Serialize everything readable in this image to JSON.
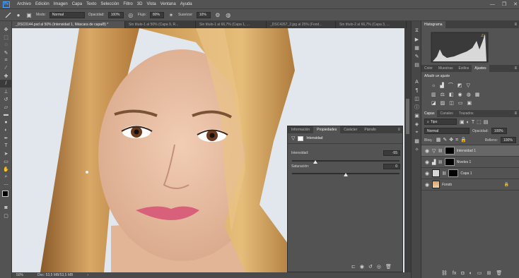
{
  "app": {
    "logo": "Ps"
  },
  "menu": [
    "Archivo",
    "Edición",
    "Imagen",
    "Capa",
    "Texto",
    "Selección",
    "Filtro",
    "3D",
    "Vista",
    "Ventana",
    "Ayuda"
  ],
  "window_controls": {
    "minimize": "—",
    "restore": "❐",
    "close": "✕"
  },
  "options": {
    "mode_label": "Modo:",
    "mode_value": "Normal",
    "opacity_label": "Opacidad:",
    "opacity_value": "100%",
    "flow_label": "Flujo:",
    "flow_value": "80%",
    "smooth_label": "Suavizar:",
    "smooth_value": "10%"
  },
  "tabs": [
    "_DSC0144.psd al 50% (Intensidad 1, Máscara de capa/8) *",
    "Sin título-1 al 50% (Capa 9, R...",
    "Sin título-1 al 66,7% (Capa 1, ...",
    "_DSC4267_2.jpg al 25% (Fond...",
    "Sin título-2 al 66,7% (Capa 3, ..."
  ],
  "status": {
    "zoom": "50%",
    "doc": "Doc: 53,5 MB/53,5 MB",
    "arrow": "›"
  },
  "properties": {
    "tabs": [
      "Información",
      "Propiedades",
      "Carácter",
      "Párrafo"
    ],
    "active_tab": 1,
    "adjustment": "Intensidad",
    "intensity_label": "Intensidad:",
    "intensity_value": "-55",
    "intensity_pos": 0.22,
    "saturation_label": "Saturación:",
    "saturation_value": "0",
    "saturation_pos": 0.5
  },
  "histogram": {
    "tab": "Histograma"
  },
  "adjust_panel": {
    "tabs": [
      "Color",
      "Muestras",
      "Estilos",
      "Ajustes"
    ],
    "title": "Añadir un ajuste"
  },
  "layers_panel": {
    "tabs": [
      "Capas",
      "Canales",
      "Trazados"
    ],
    "filter": "Tipo",
    "blend": "Normal",
    "opacity_label": "Opacidad:",
    "opacity_value": "100%",
    "lock_label": "Bloq.:",
    "fill_label": "Relleno:",
    "fill_value": "100%",
    "layers": [
      {
        "name": "Intensidad 1",
        "selected": true
      },
      {
        "name": "Niveles 1",
        "selected": false
      },
      {
        "name": "Capa 1",
        "selected": false
      },
      {
        "name": "Fondo",
        "selected": false
      }
    ]
  }
}
